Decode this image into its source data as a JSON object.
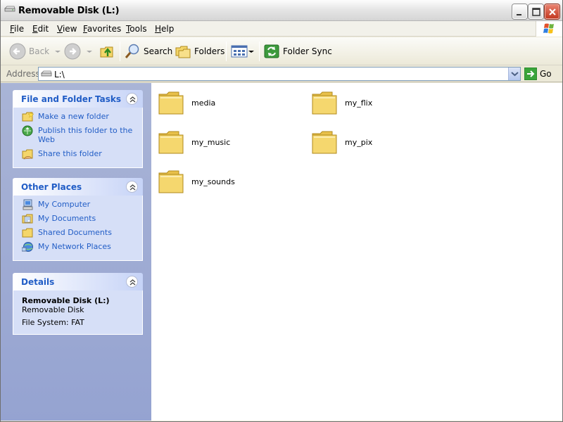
{
  "window": {
    "title": "Removable Disk (L:)"
  },
  "menu": [
    {
      "label": "File",
      "u": "F",
      "rest": "ile"
    },
    {
      "label": "Edit",
      "u": "E",
      "rest": "dit"
    },
    {
      "label": "View",
      "u": "V",
      "rest": "iew"
    },
    {
      "label": "Favorites",
      "u": "F",
      "rest": "avorites",
      "pre": ""
    },
    {
      "label": "Tools",
      "u": "T",
      "rest": "ools"
    },
    {
      "label": "Help",
      "u": "H",
      "rest": "elp"
    }
  ],
  "toolbar": {
    "back_label": "Back",
    "search_label": "Search",
    "folders_label": "Folders",
    "folder_sync_label": "Folder Sync"
  },
  "address": {
    "label": "Address",
    "value": "L:\\",
    "go_label": "Go"
  },
  "panels": {
    "tasks": {
      "title": "File and Folder Tasks",
      "items": [
        "Make a new folder",
        "Publish this folder to the Web",
        "Share this folder"
      ]
    },
    "places": {
      "title": "Other Places",
      "items": [
        "My Computer",
        "My Documents",
        "Shared Documents",
        "My Network Places"
      ]
    },
    "details": {
      "title": "Details",
      "name": "Removable Disk (L:)",
      "type": "Removable Disk",
      "filesystem": "File System: FAT"
    }
  },
  "folders": [
    "media",
    "my_flix",
    "my_music",
    "my_pix",
    "my_sounds"
  ],
  "colors": {
    "link_blue": "#215dc6",
    "panel_bg": "#d6dff7",
    "folder_yellow": "#f5d76e"
  }
}
